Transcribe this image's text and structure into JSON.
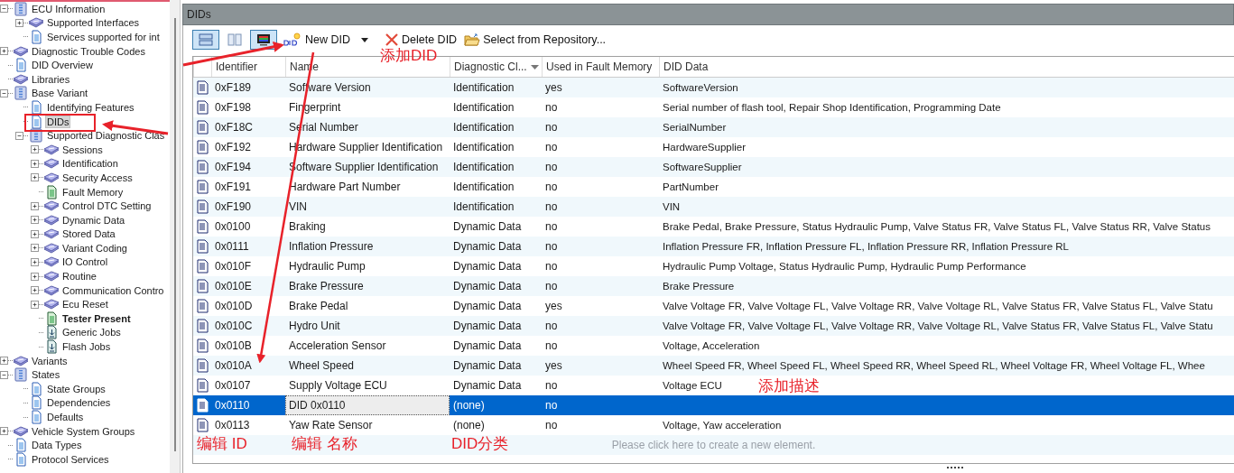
{
  "tree": [
    {
      "label": "ECU Information",
      "kind": "binder",
      "expanded": true,
      "selected": false,
      "bold": false,
      "children": [
        {
          "label": "Supported Interfaces",
          "kind": "book",
          "expanded": false,
          "selected": false,
          "bold": false
        },
        {
          "label": "Services supported for int",
          "kind": "page",
          "selected": false,
          "bold": false
        }
      ]
    },
    {
      "label": "Diagnostic Trouble Codes",
      "kind": "book",
      "expanded": false,
      "selected": false,
      "bold": false
    },
    {
      "label": "DID Overview",
      "kind": "page",
      "selected": false,
      "bold": false
    },
    {
      "label": "Libraries",
      "kind": "book",
      "selected": false,
      "bold": false
    },
    {
      "label": "Base Variant",
      "kind": "binder",
      "expanded": true,
      "selected": false,
      "bold": false,
      "children": [
        {
          "label": "Identifying Features",
          "kind": "page",
          "selected": false,
          "bold": false
        },
        {
          "label": "DIDs",
          "kind": "page",
          "selected": true,
          "bold": false
        },
        {
          "label": "Supported Diagnostic Clas",
          "kind": "binder",
          "expanded": true,
          "selected": false,
          "bold": false,
          "children": [
            {
              "label": "Sessions",
              "kind": "book",
              "expanded": false,
              "selected": false,
              "bold": false
            },
            {
              "label": "Identification",
              "kind": "book",
              "expanded": false,
              "selected": false,
              "bold": false
            },
            {
              "label": "Security Access",
              "kind": "book",
              "expanded": false,
              "selected": false,
              "bold": false
            },
            {
              "label": "Fault Memory",
              "kind": "service",
              "selected": false,
              "bold": false
            },
            {
              "label": "Control DTC Setting",
              "kind": "book",
              "expanded": false,
              "selected": false,
              "bold": false
            },
            {
              "label": "Dynamic Data",
              "kind": "book",
              "expanded": false,
              "selected": false,
              "bold": false
            },
            {
              "label": "Stored Data",
              "kind": "book",
              "expanded": false,
              "selected": false,
              "bold": false
            },
            {
              "label": "Variant Coding",
              "kind": "book",
              "expanded": false,
              "selected": false,
              "bold": false
            },
            {
              "label": "IO Control",
              "kind": "book",
              "expanded": false,
              "selected": false,
              "bold": false
            },
            {
              "label": "Routine",
              "kind": "book",
              "expanded": false,
              "selected": false,
              "bold": false
            },
            {
              "label": "Communication Contro",
              "kind": "book",
              "expanded": false,
              "selected": false,
              "bold": false
            },
            {
              "label": "Ecu Reset",
              "kind": "book",
              "expanded": false,
              "selected": false,
              "bold": false
            },
            {
              "label": "Tester Present",
              "kind": "service",
              "selected": false,
              "bold": true
            },
            {
              "label": "Generic Jobs",
              "kind": "job",
              "selected": false,
              "bold": false
            },
            {
              "label": "Flash Jobs",
              "kind": "job",
              "selected": false,
              "bold": false
            }
          ]
        }
      ]
    },
    {
      "label": "Variants",
      "kind": "book",
      "expanded": false,
      "selected": false,
      "bold": false
    },
    {
      "label": "States",
      "kind": "binder",
      "expanded": true,
      "selected": false,
      "bold": false,
      "children": [
        {
          "label": "State Groups",
          "kind": "page",
          "selected": false,
          "bold": false
        },
        {
          "label": "Dependencies",
          "kind": "page",
          "selected": false,
          "bold": false
        },
        {
          "label": "Defaults",
          "kind": "page",
          "selected": false,
          "bold": false
        }
      ]
    },
    {
      "label": "Vehicle System Groups",
      "kind": "book",
      "expanded": false,
      "selected": false,
      "bold": false
    },
    {
      "label": "Data Types",
      "kind": "page",
      "selected": false,
      "bold": false
    },
    {
      "label": "Protocol Services",
      "kind": "page",
      "selected": false,
      "bold": false
    }
  ],
  "panel": {
    "title": "DIDs"
  },
  "toolbar": {
    "view_toggles": [
      {
        "kind": "rows",
        "selected": true
      },
      {
        "kind": "columns",
        "selected": false
      },
      {
        "kind": "monitor",
        "selected": true
      }
    ],
    "new_button": "New DID",
    "delete_button": "Delete DID",
    "repository_button": "Select from Repository..."
  },
  "table": {
    "columns": [
      "Identifier",
      "Name",
      "Diagnostic Cl...",
      "Used in Fault Memory",
      "DID Data"
    ],
    "rows": [
      {
        "identifier": "0xF189",
        "name": "Software Version",
        "diagnostic_class": "Identification",
        "used_in_fault_memory": "yes",
        "did_data": "SoftwareVersion",
        "selected": false,
        "editing": false
      },
      {
        "identifier": "0xF198",
        "name": "Fingerprint",
        "diagnostic_class": "Identification",
        "used_in_fault_memory": "no",
        "did_data": "Serial number of flash tool, Repair Shop Identification, Programming Date",
        "selected": false,
        "editing": false
      },
      {
        "identifier": "0xF18C",
        "name": "Serial Number",
        "diagnostic_class": "Identification",
        "used_in_fault_memory": "no",
        "did_data": "SerialNumber",
        "selected": false,
        "editing": false
      },
      {
        "identifier": "0xF192",
        "name": "Hardware Supplier Identification",
        "diagnostic_class": "Identification",
        "used_in_fault_memory": "no",
        "did_data": "HardwareSupplier",
        "selected": false,
        "editing": false
      },
      {
        "identifier": "0xF194",
        "name": "Software Supplier Identification",
        "diagnostic_class": "Identification",
        "used_in_fault_memory": "no",
        "did_data": "SoftwareSupplier",
        "selected": false,
        "editing": false
      },
      {
        "identifier": "0xF191",
        "name": "Hardware Part Number",
        "diagnostic_class": "Identification",
        "used_in_fault_memory": "no",
        "did_data": "PartNumber",
        "selected": false,
        "editing": false
      },
      {
        "identifier": "0xF190",
        "name": "VIN",
        "diagnostic_class": "Identification",
        "used_in_fault_memory": "no",
        "did_data": "VIN",
        "selected": false,
        "editing": false
      },
      {
        "identifier": "0x0100",
        "name": "Braking",
        "diagnostic_class": "Dynamic Data",
        "used_in_fault_memory": "no",
        "did_data": "Brake Pedal, Brake Pressure, Status Hydraulic Pump, Valve Status FR, Valve Status FL, Valve Status RR, Valve Status",
        "selected": false,
        "editing": false
      },
      {
        "identifier": "0x0111",
        "name": "Inflation Pressure",
        "diagnostic_class": "Dynamic Data",
        "used_in_fault_memory": "no",
        "did_data": "Inflation Pressure FR, Inflation Pressure FL, Inflation Pressure RR, Inflation Pressure RL",
        "selected": false,
        "editing": false
      },
      {
        "identifier": "0x010F",
        "name": "Hydraulic Pump",
        "diagnostic_class": "Dynamic Data",
        "used_in_fault_memory": "no",
        "did_data": "Hydraulic Pump Voltage, Status Hydraulic Pump, Hydraulic Pump Performance",
        "selected": false,
        "editing": false
      },
      {
        "identifier": "0x010E",
        "name": "Brake Pressure",
        "diagnostic_class": "Dynamic Data",
        "used_in_fault_memory": "no",
        "did_data": "Brake Pressure",
        "selected": false,
        "editing": false
      },
      {
        "identifier": "0x010D",
        "name": "Brake Pedal",
        "diagnostic_class": "Dynamic Data",
        "used_in_fault_memory": "yes",
        "did_data": "Valve Voltage FR, Valve Voltage FL, Valve Voltage RR, Valve Voltage RL, Valve Status FR, Valve Status FL, Valve Statu",
        "selected": false,
        "editing": false
      },
      {
        "identifier": "0x010C",
        "name": "Hydro Unit",
        "diagnostic_class": "Dynamic Data",
        "used_in_fault_memory": "no",
        "did_data": "Valve Voltage FR, Valve Voltage FL, Valve Voltage RR, Valve Voltage RL, Valve Status FR, Valve Status FL, Valve Statu",
        "selected": false,
        "editing": false
      },
      {
        "identifier": "0x010B",
        "name": "Acceleration Sensor",
        "diagnostic_class": "Dynamic Data",
        "used_in_fault_memory": "no",
        "did_data": "Voltage, Acceleration",
        "selected": false,
        "editing": false
      },
      {
        "identifier": "0x010A",
        "name": "Wheel Speed",
        "diagnostic_class": "Dynamic Data",
        "used_in_fault_memory": "yes",
        "did_data": "Wheel Speed FR, Wheel Speed FL, Wheel Speed RR, Wheel Speed RL, Wheel Voltage FR, Wheel Voltage FL, Whee",
        "selected": false,
        "editing": false
      },
      {
        "identifier": "0x0107",
        "name": "Supply Voltage ECU",
        "diagnostic_class": "Dynamic Data",
        "used_in_fault_memory": "no",
        "did_data": "Voltage ECU",
        "selected": false,
        "editing": false
      },
      {
        "identifier": "0x0110",
        "name": "DID 0x0110",
        "diagnostic_class": "(none)",
        "used_in_fault_memory": "no",
        "selected": true,
        "editing": true
      },
      {
        "identifier": "0x0113",
        "name": "Yaw Rate Sensor",
        "diagnostic_class": "(none)",
        "used_in_fault_memory": "no",
        "did_data": "Voltage, Yaw acceleration",
        "selected": false,
        "editing": false
      }
    ],
    "new_element_hint": "Please click here to create a new element."
  },
  "annotations": [
    {
      "text": "添加DID"
    },
    {
      "text": "添加描述"
    },
    {
      "text": "编辑 ID"
    },
    {
      "text": "编辑 名称"
    },
    {
      "text": "DID分类"
    }
  ]
}
